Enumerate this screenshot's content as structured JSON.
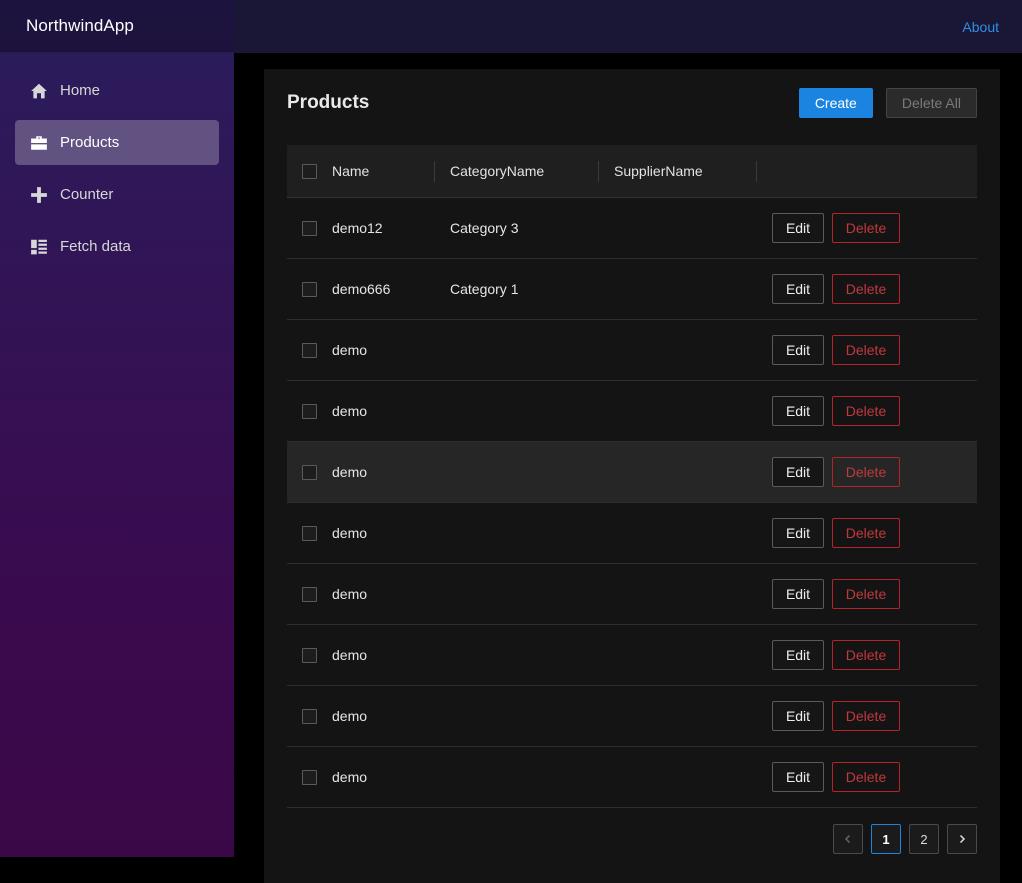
{
  "app": {
    "brand": "NorthwindApp",
    "about": "About"
  },
  "sidebar": {
    "items": [
      {
        "label": "Home",
        "icon": "home-icon",
        "active": false
      },
      {
        "label": "Products",
        "icon": "briefcase-icon",
        "active": true
      },
      {
        "label": "Counter",
        "icon": "plus-icon",
        "active": false
      },
      {
        "label": "Fetch data",
        "icon": "list-icon",
        "active": false
      }
    ]
  },
  "page": {
    "title": "Products",
    "create_label": "Create",
    "delete_all_label": "Delete All"
  },
  "table": {
    "columns": [
      "Name",
      "CategoryName",
      "SupplierName"
    ],
    "edit_label": "Edit",
    "delete_label": "Delete",
    "rows": [
      {
        "name": "demo12",
        "category": "Category 3",
        "supplier": ""
      },
      {
        "name": "demo666",
        "category": "Category 1",
        "supplier": ""
      },
      {
        "name": "demo",
        "category": "",
        "supplier": ""
      },
      {
        "name": "demo",
        "category": "",
        "supplier": ""
      },
      {
        "name": "demo",
        "category": "",
        "supplier": ""
      },
      {
        "name": "demo",
        "category": "",
        "supplier": ""
      },
      {
        "name": "demo",
        "category": "",
        "supplier": ""
      },
      {
        "name": "demo",
        "category": "",
        "supplier": ""
      },
      {
        "name": "demo",
        "category": "",
        "supplier": ""
      },
      {
        "name": "demo",
        "category": "",
        "supplier": ""
      }
    ]
  },
  "pager": {
    "pages": [
      "1",
      "2"
    ],
    "current": "1"
  },
  "colors": {
    "accent": "#1b84e0",
    "danger": "#c0393d",
    "link": "#2f8fe8"
  }
}
